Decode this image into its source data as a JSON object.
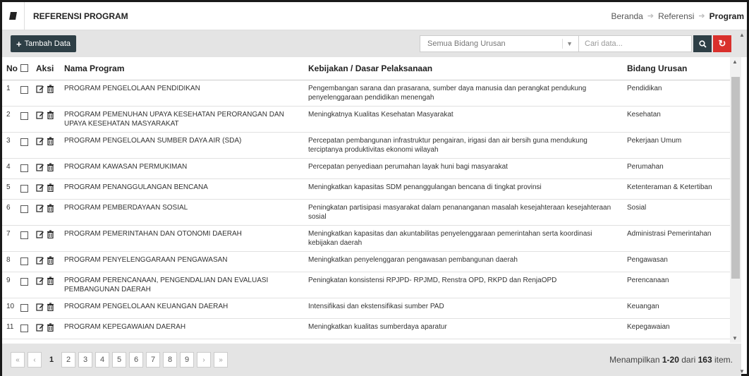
{
  "header": {
    "title": "REFERENSI PROGRAM",
    "breadcrumb": [
      "Beranda",
      "Referensi",
      "Program"
    ]
  },
  "toolbar": {
    "add_label": "Tambah Data",
    "bidang_select": "Semua Bidang Urusan",
    "search_placeholder": "Cari data..."
  },
  "table": {
    "columns": [
      "No",
      "",
      "Aksi",
      "Nama Program",
      "Kebijakan / Dasar Pelaksanaan",
      "Bidang Urusan"
    ],
    "rows": [
      {
        "no": "1",
        "nama": "PROGRAM PENGELOLAAN PENDIDIKAN",
        "kebijakan": "Pengembangan sarana dan prasarana, sumber daya manusia dan perangkat pendukung penyelenggaraan pendidikan menengah",
        "bidang": "Pendidikan"
      },
      {
        "no": "2",
        "nama": "PROGRAM PEMENUHAN UPAYA KESEHATAN PERORANGAN DAN UPAYA KESEHATAN MASYARAKAT",
        "kebijakan": "Meningkatnya Kualitas Kesehatan Masyarakat",
        "bidang": "Kesehatan"
      },
      {
        "no": "3",
        "nama": "PROGRAM PENGELOLAAN SUMBER DAYA AIR (SDA)",
        "kebijakan": "Percepatan pembangunan infrastruktur pengairan, irigasi dan air bersih guna mendukung terciptanya produktivitas ekonomi wilayah",
        "bidang": "Pekerjaan Umum"
      },
      {
        "no": "4",
        "nama": "PROGRAM KAWASAN PERMUKIMAN",
        "kebijakan": "Percepatan penyediaan perumahan layak huni bagi masyarakat",
        "bidang": "Perumahan"
      },
      {
        "no": "5",
        "nama": "PROGRAM PENANGGULANGAN BENCANA",
        "kebijakan": "Meningkatkan kapasitas SDM penanggulangan bencana di tingkat provinsi",
        "bidang": "Ketenteraman & Ketertiban"
      },
      {
        "no": "6",
        "nama": "PROGRAM PEMBERDAYAAN SOSIAL",
        "kebijakan": "Peningkatan partisipasi masyarakat dalam penananganan masalah kesejahteraan kesejahteraan sosial",
        "bidang": "Sosial"
      },
      {
        "no": "7",
        "nama": "PROGRAM PEMERINTAHAN DAN OTONOMI DAERAH",
        "kebijakan": "Meningkatkan kapasitas dan akuntabilitas penyelenggaraan pemerintahan serta koordinasi kebijakan daerah",
        "bidang": "Administrasi Pemerintahan"
      },
      {
        "no": "8",
        "nama": "PROGRAM PENYELENGGARAAN PENGAWASAN",
        "kebijakan": "Meningkatkan penyelenggaran pengawasan pembangunan daerah",
        "bidang": "Pengawasan"
      },
      {
        "no": "9",
        "nama": "PROGRAM PERENCANAAN, PENGENDALIAN DAN EVALUASI PEMBANGUNAN DAERAH",
        "kebijakan": "Peningkatan konsistensi RPJPD- RPJMD, Renstra OPD, RKPD dan RenjaOPD",
        "bidang": "Perencanaan"
      },
      {
        "no": "10",
        "nama": "PROGRAM PENGELOLAAN KEUANGAN DAERAH",
        "kebijakan": "Intensifikasi dan ekstensifikasi sumber PAD",
        "bidang": "Keuangan"
      },
      {
        "no": "11",
        "nama": "PROGRAM KEPEGAWAIAN DAERAH",
        "kebijakan": "Meningkatkan kualitas sumberdaya aparatur",
        "bidang": "Kepegawaian"
      }
    ]
  },
  "pagination": {
    "first": "«",
    "prev": "‹",
    "pages": [
      "1",
      "2",
      "3",
      "4",
      "5",
      "6",
      "7",
      "8",
      "9"
    ],
    "current": "1",
    "next": "›",
    "last": "»"
  },
  "summary": {
    "prefix": "Menampilkan",
    "range": "1-20",
    "middle": "dari",
    "total": "163",
    "suffix": "item."
  },
  "colors": {
    "dark_button": "#2e3f46",
    "refresh_button": "#d9302c",
    "toolbar_bg": "#e4e4e4"
  }
}
